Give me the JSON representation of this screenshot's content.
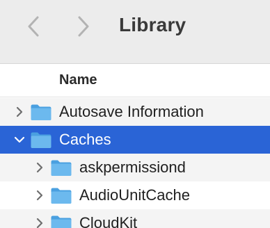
{
  "window": {
    "title": "Library"
  },
  "toolbar": {
    "back_icon": "chevron-left-icon",
    "forward_icon": "chevron-right-icon"
  },
  "list": {
    "column_header": "Name",
    "rows": [
      {
        "label": "Autosave Information",
        "expanded": false,
        "selected": false,
        "depth": 0
      },
      {
        "label": "Caches",
        "expanded": true,
        "selected": true,
        "depth": 0
      },
      {
        "label": "askpermissiond",
        "expanded": false,
        "selected": false,
        "depth": 1
      },
      {
        "label": "AudioUnitCache",
        "expanded": false,
        "selected": false,
        "depth": 1
      },
      {
        "label": "CloudKit",
        "expanded": false,
        "selected": false,
        "depth": 1
      }
    ]
  },
  "colors": {
    "selection": "#2a64d6",
    "folder": "#6cb9ee",
    "toolbar_bg": "#ececec"
  }
}
